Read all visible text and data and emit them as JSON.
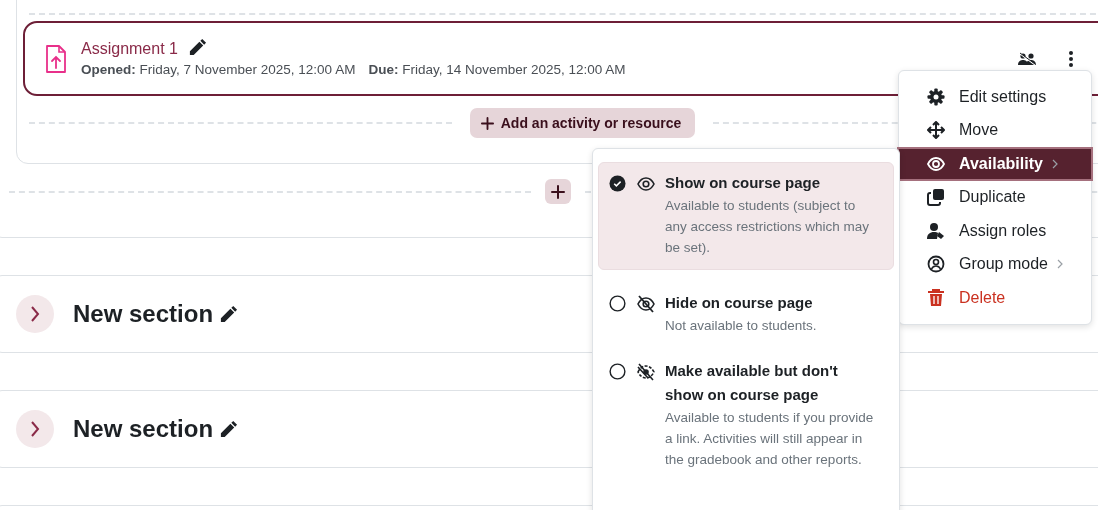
{
  "activity": {
    "name": "Assignment 1",
    "dates": [
      {
        "label": "Opened:",
        "value": "Friday, 7 November 2025, 12:00 AM"
      },
      {
        "label": "Due:",
        "value": "Friday, 14 November 2025, 12:00 AM"
      }
    ]
  },
  "add_activity_button": {
    "label": "Add an activity or resource"
  },
  "sections": [
    {
      "title": "New section",
      "expanded": false
    },
    {
      "title": "New section",
      "expanded": false
    }
  ],
  "action_menu": {
    "items": [
      {
        "label": "Edit settings",
        "kind": "settings",
        "selected": false,
        "has_submenu": false
      },
      {
        "label": "Move",
        "kind": "move",
        "selected": false,
        "has_submenu": false
      },
      {
        "label": "Availability",
        "kind": "availability",
        "selected": true,
        "has_submenu": true
      },
      {
        "label": "Duplicate",
        "kind": "duplicate",
        "selected": false,
        "has_submenu": false
      },
      {
        "label": "Assign roles",
        "kind": "roles",
        "selected": false,
        "has_submenu": false
      },
      {
        "label": "Group mode",
        "kind": "group",
        "selected": false,
        "has_submenu": true
      },
      {
        "label": "Delete",
        "kind": "delete",
        "selected": false,
        "has_submenu": false
      }
    ]
  },
  "availability_menu": {
    "options": [
      {
        "title": "Show on course page",
        "description": "Available to students (subject to any access restrictions which may be set).",
        "kind": "show",
        "selected": true
      },
      {
        "title": "Hide on course page",
        "description": "Not available to students.",
        "kind": "hide",
        "selected": false
      },
      {
        "title": "Make available but don't show on course page",
        "description": "Available to students if you provide a link. Activities will still appear in the gradebook and other reports.",
        "kind": "stealth",
        "selected": false
      }
    ]
  }
}
